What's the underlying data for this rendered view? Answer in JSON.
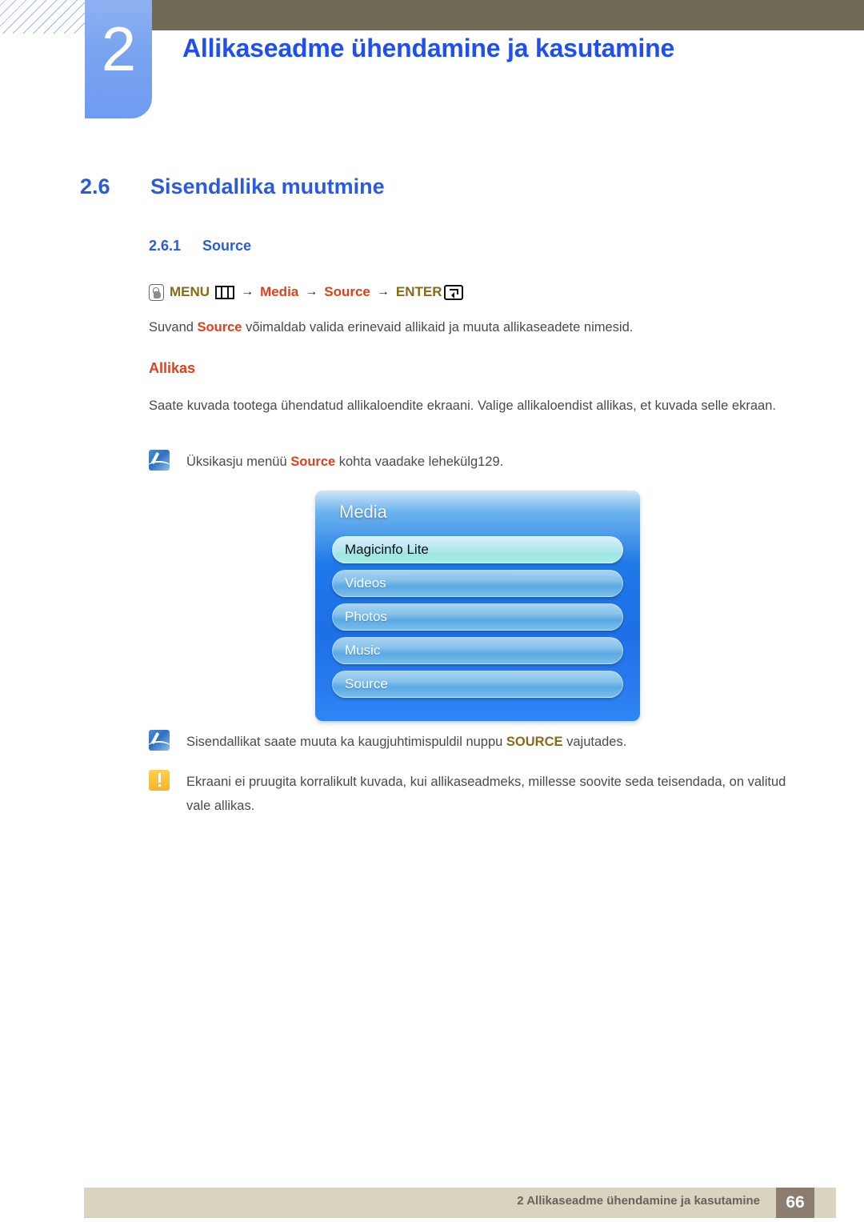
{
  "header": {
    "chapter_number": "2",
    "chapter_title": "Allikaseadme ühendamine ja kasutamine"
  },
  "section": {
    "number": "2.6",
    "title": "Sisendallika muutmine",
    "sub_number": "2.6.1",
    "sub_title": "Source"
  },
  "menu_path": {
    "hand_icon": "hand-press-icon",
    "menu_label": "MENU",
    "menu_icon": "menu-bars-icon",
    "arrow": "→",
    "item1": "Media",
    "item2": "Source",
    "enter_label": "ENTER",
    "enter_icon": "enter-key-icon"
  },
  "body": {
    "intro_pre": "Suvand ",
    "intro_bold": "Source",
    "intro_post": " võimaldab valida erinevaid allikaid ja muuta allikaseadete nimesid.",
    "subheading": "Allikas",
    "description": "Saate kuvada tootega ühendatud allikaloendite ekraani. Valige allikaloendist allikas, et kuvada selle ekraan."
  },
  "notes": [
    {
      "icon": "note-pen-icon",
      "pre": "Üksikasju menüü ",
      "bold": "Source",
      "bold_style": "orange",
      "post": " kohta vaadake lehekülg129."
    },
    {
      "icon": "note-pen-icon",
      "pre": "Sisendallikat saate muuta ka kaugjuhtimispuldil nuppu ",
      "bold": "SOURCE",
      "bold_style": "gold",
      "post": " vajutades."
    },
    {
      "icon": "warning-icon",
      "pre": "Ekraani ei pruugita korralikult kuvada, kui allikaseadmeks, millesse soovite seda teisendada, on valitud vale allikas.",
      "bold": "",
      "bold_style": "none",
      "post": ""
    }
  ],
  "osd": {
    "title": "Media",
    "items": [
      {
        "label": "Magicinfo Lite",
        "selected": true
      },
      {
        "label": "Videos",
        "selected": false
      },
      {
        "label": "Photos",
        "selected": false
      },
      {
        "label": "Music",
        "selected": false
      },
      {
        "label": "Source",
        "selected": false
      }
    ]
  },
  "footer": {
    "text": "2 Allikaseadme ühendamine ja kasutamine",
    "page_number": "66"
  },
  "colors": {
    "title_blue": "#1f50ef",
    "heading_blue": "#2a5bde",
    "orange": "#e0401a",
    "gold": "#8a6a12",
    "olive_bar": "#6e6a53",
    "footer_bar": "#d9d4c0",
    "footer_page_box": "#8c7d70",
    "badge_blue": "#7ba4f0",
    "osd_blue": "#1f78e8"
  }
}
